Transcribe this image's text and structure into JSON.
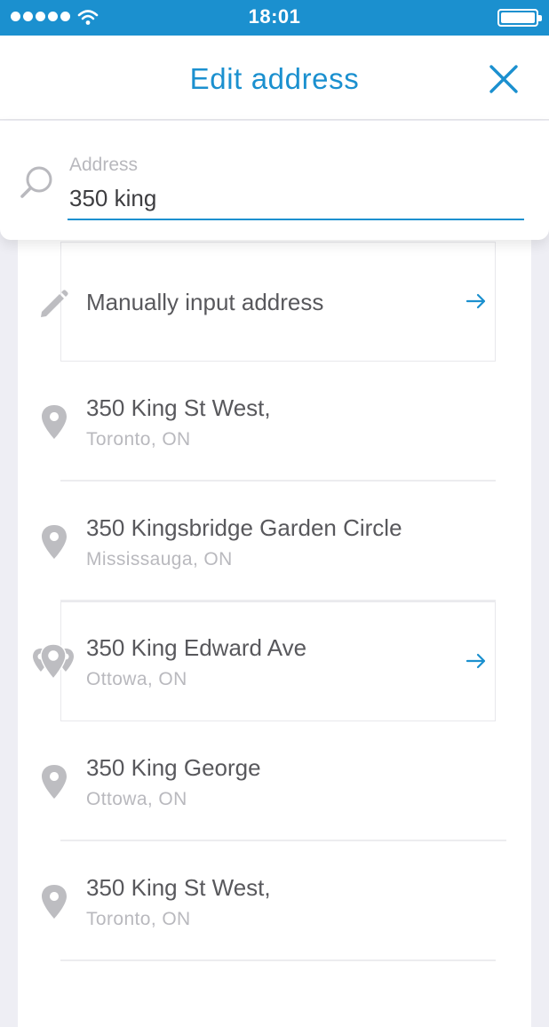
{
  "status_bar": {
    "time": "18:01"
  },
  "header": {
    "title": "Edit address"
  },
  "search": {
    "label": "Address",
    "value": "350 king"
  },
  "results": [
    {
      "title": "Manually input address",
      "subtitle": "",
      "icon": "pencil-icon"
    },
    {
      "title": "350 King St West,",
      "subtitle": "Toronto, ON",
      "icon": "map-pin-icon"
    },
    {
      "title": "350 Kingsbridge Garden Circle",
      "subtitle": "Mississauga, ON",
      "icon": "map-pin-icon"
    },
    {
      "title": "350 King Edward Ave",
      "subtitle": "Ottowa, ON",
      "icon": "multiple-map-pins-icon"
    },
    {
      "title": "350 King George",
      "subtitle": "Ottowa, ON",
      "icon": "map-pin-icon"
    },
    {
      "title": "350 King St West,",
      "subtitle": "Toronto, ON",
      "icon": "map-pin-icon"
    }
  ],
  "colors": {
    "accent": "#1b90cf",
    "icon_gray": "#bdbdc1",
    "primary_text": "#58585c",
    "secondary_text": "#b9b9be"
  }
}
